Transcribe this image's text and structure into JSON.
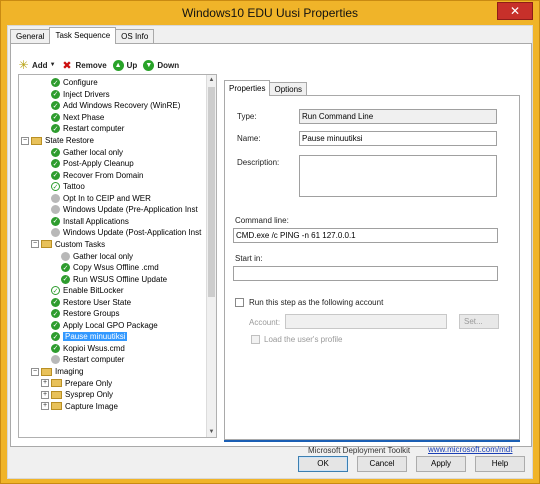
{
  "window": {
    "title": "Windows10 EDU Uusi Properties",
    "close_glyph": "✕"
  },
  "tabs": [
    "General",
    "Task Sequence",
    "OS Info"
  ],
  "toolbar": {
    "add": "Add",
    "remove": "Remove",
    "up": "Up",
    "down": "Down"
  },
  "tree": {
    "items": [
      {
        "label": "Configure",
        "state": "ok"
      },
      {
        "label": "Inject Drivers",
        "state": "ok"
      },
      {
        "label": "Add Windows Recovery (WinRE)",
        "state": "ok"
      },
      {
        "label": "Next Phase",
        "state": "ok"
      },
      {
        "label": "Restart computer",
        "state": "ok"
      },
      {
        "label": "State Restore",
        "state": "folder"
      },
      {
        "label": "Gather local only",
        "state": "ok"
      },
      {
        "label": "Post-Apply Cleanup",
        "state": "ok"
      },
      {
        "label": "Recover From Domain",
        "state": "ok"
      },
      {
        "label": "Tattoo",
        "state": "partial"
      },
      {
        "label": "Opt In to CEIP and WER",
        "state": "disabled"
      },
      {
        "label": "Windows Update (Pre-Application Inst",
        "state": "disabled"
      },
      {
        "label": "Install Applications",
        "state": "ok"
      },
      {
        "label": "Windows Update (Post-Application Inst",
        "state": "disabled"
      },
      {
        "label": "Custom Tasks",
        "state": "folder"
      },
      {
        "label": "Gather local only",
        "state": "disabled"
      },
      {
        "label": "Copy Wsus Offline .cmd",
        "state": "ok"
      },
      {
        "label": "Run WSUS Offline Update",
        "state": "ok"
      },
      {
        "label": "Enable BitLocker",
        "state": "partial"
      },
      {
        "label": "Restore User State",
        "state": "ok"
      },
      {
        "label": "Restore Groups",
        "state": "ok"
      },
      {
        "label": "Apply Local GPO Package",
        "state": "ok"
      },
      {
        "label": "Pause minuutiksi",
        "state": "ok"
      },
      {
        "label": "Kopioi Wsus.cmd",
        "state": "ok"
      },
      {
        "label": "Restart computer",
        "state": "disabled"
      },
      {
        "label": "Imaging",
        "state": "folder"
      },
      {
        "label": "Prepare Only",
        "state": "folder"
      },
      {
        "label": "Sysprep Only",
        "state": "folder"
      },
      {
        "label": "Capture Image",
        "state": "folder"
      }
    ],
    "selected_index": 22
  },
  "inner_tabs": [
    "Properties",
    "Options"
  ],
  "properties": {
    "type_label": "Type:",
    "type_value": "Run Command Line",
    "name_label": "Name:",
    "name_value": "Pause minuutiksi",
    "description_label": "Description:",
    "description_value": "",
    "command_label": "Command line:",
    "command_value": "CMD.exe /c PING -n 61 127.0.0.1",
    "startin_label": "Start in:",
    "startin_value": "",
    "runas_label": "Run this step as the following account",
    "account_label": "Account:",
    "account_value": "",
    "set_label": "Set...",
    "loadprofile_label": "Load the user's profile"
  },
  "footer": {
    "brand": "Microsoft Deployment Toolkit",
    "link": "www.microsoft.com/mdt"
  },
  "buttons": {
    "ok": "OK",
    "cancel": "Cancel",
    "apply": "Apply",
    "help": "Help"
  }
}
